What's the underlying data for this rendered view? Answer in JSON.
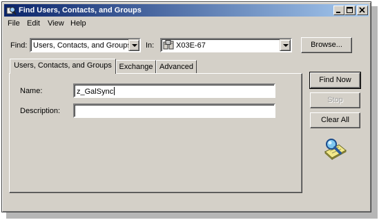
{
  "window": {
    "title": "Find Users, Contacts, and Groups",
    "controls": {
      "minimize": "_",
      "maximize": "□",
      "close": "✕"
    }
  },
  "menu": [
    "File",
    "Edit",
    "View",
    "Help"
  ],
  "find": {
    "label": "Find:",
    "value": "Users, Contacts, and Groups",
    "in_label": "In:",
    "in_value": "X03E-67",
    "browse_label": "Browse..."
  },
  "tabs": [
    {
      "label": "Users, Contacts, and Groups",
      "active": true
    },
    {
      "label": "Exchange",
      "active": false
    },
    {
      "label": "Advanced",
      "active": false
    }
  ],
  "form": {
    "name_label": "Name:",
    "name_value": "z_GalSync",
    "description_label": "Description:",
    "description_value": ""
  },
  "actions": {
    "find_now": "Find Now",
    "stop": "Stop",
    "clear_all": "Clear All"
  },
  "icons": {
    "title": "search-directory-icon",
    "in": "domain-icon",
    "illustration": "magnifier-search-icon"
  }
}
